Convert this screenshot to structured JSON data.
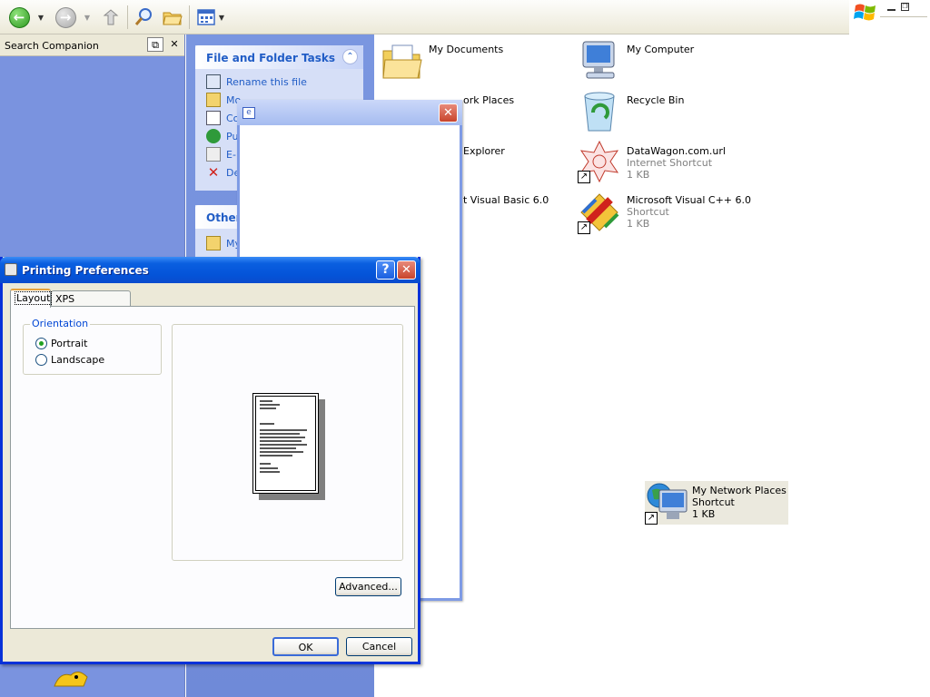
{
  "toolbar": {
    "buttons": [
      "back",
      "forward",
      "up",
      "search",
      "folders",
      "views"
    ]
  },
  "search_companion": {
    "title": "Search Companion"
  },
  "tasks": {
    "file_folder": {
      "title": "File and Folder Tasks",
      "items": [
        "Rename this file",
        "Mo",
        "Co",
        "Pu",
        "E-",
        "De"
      ]
    },
    "other": {
      "title": "Other",
      "items": [
        "My"
      ]
    }
  },
  "desktop": {
    "items": [
      {
        "name": "My Documents"
      },
      {
        "name": "My Computer"
      },
      {
        "name": "ork Places"
      },
      {
        "name": "Recycle Bin"
      },
      {
        "name": "Explorer"
      },
      {
        "name": "DataWagon.com.url",
        "type": "Internet Shortcut",
        "size": "1 KB"
      },
      {
        "name": "t Visual Basic 6.0"
      },
      {
        "name": "Microsoft Visual C++ 6.0",
        "type": "Shortcut",
        "size": "1 KB"
      },
      {
        "name": "My Network Places",
        "type": "Shortcut",
        "size": "1 KB"
      }
    ]
  },
  "dialog": {
    "title": "Printing Preferences",
    "help": "?",
    "close": "✕",
    "tabs": [
      "Layout",
      "XPS Documents"
    ],
    "orientation": {
      "label": "Orientation",
      "options": [
        "Portrait",
        "Landscape"
      ],
      "selected": "Portrait"
    },
    "advanced": "Advanced...",
    "ok": "OK",
    "cancel": "Cancel"
  },
  "colors": {
    "xp_title_blue": "#0453d8",
    "task_link": "#215dc6",
    "search_bg": "#7a93df"
  }
}
